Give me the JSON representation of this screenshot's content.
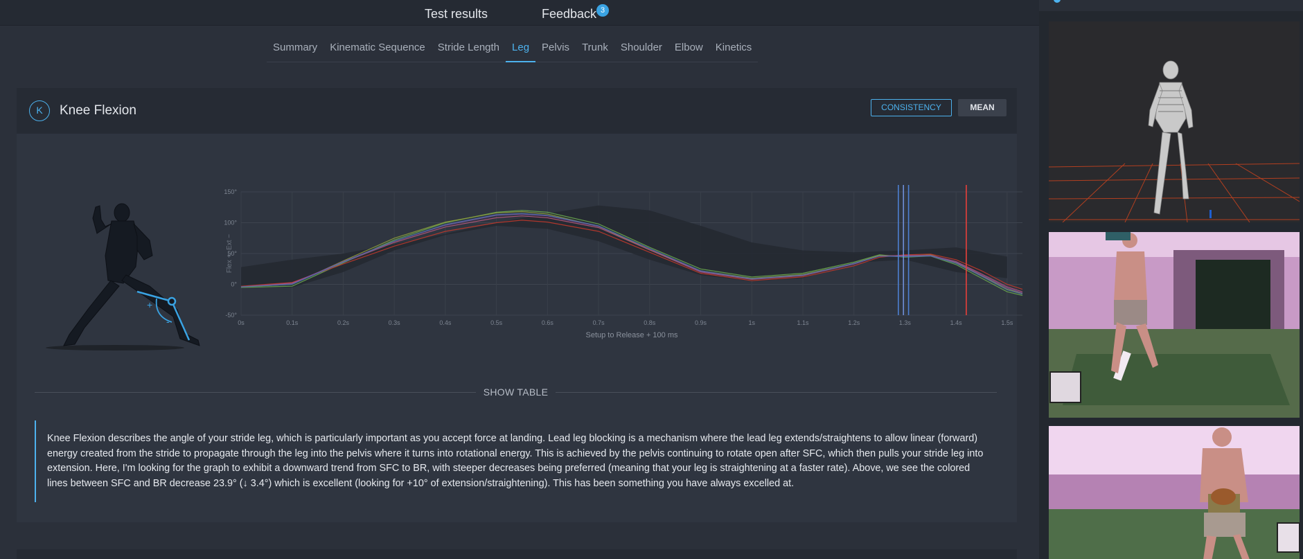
{
  "top_nav": {
    "tabs": [
      "Test results",
      "Feedback"
    ],
    "feedback_badge": "3"
  },
  "sub_tabs": [
    {
      "label": "Summary",
      "active": false
    },
    {
      "label": "Kinematic Sequence",
      "active": false
    },
    {
      "label": "Stride Length",
      "active": false
    },
    {
      "label": "Leg",
      "active": true
    },
    {
      "label": "Pelvis",
      "active": false
    },
    {
      "label": "Trunk",
      "active": false
    },
    {
      "label": "Shoulder",
      "active": false
    },
    {
      "label": "Elbow",
      "active": false
    },
    {
      "label": "Kinetics",
      "active": false
    }
  ],
  "card": {
    "icon_letter": "K",
    "title": "Knee Flexion",
    "btn_consistency": "CONSISTENCY",
    "btn_mean": "MEAN",
    "figure": {
      "plus": "+",
      "minus": "-"
    },
    "show_table": "SHOW TABLE",
    "description": "Knee Flexion describes the angle of your stride leg, which is particularly important as you accept force at landing. Lead leg blocking is a mechanism where the lead leg extends/straightens to allow linear (forward) energy created from the stride to propagate through the leg into the pelvis where it turns into rotational energy. This is achieved by the pelvis continuing to rotate open after SFC, which then pulls your stride leg into extension. Here, I'm looking for the graph to exhibit a downward trend from SFC to BR, with steeper decreases being preferred (meaning that your leg is straightening at a faster rate). Above, we see the colored lines between SFC and BR decrease 23.9° (↓ 3.4°) which is excellent (looking for +10° of extension/straightening). This has been something you have always excelled at."
  },
  "colors": {
    "accent": "#4db2ee",
    "background": "#2b303a",
    "card": "#2f3540",
    "release_line": "#e8403a"
  },
  "chart_data": {
    "type": "line",
    "xlabel": "Setup to Release + 100 ms",
    "ylabel": "Flex +, Ext −",
    "xlim": [
      0,
      1.53
    ],
    "ylim": [
      -50,
      150
    ],
    "x_ticks": [
      0,
      0.1,
      0.2,
      0.3,
      0.4,
      0.5,
      0.6,
      0.7,
      0.8,
      0.9,
      1.0,
      1.1,
      1.2,
      1.3,
      1.4,
      1.5
    ],
    "x_tick_labels": [
      "0s",
      "0.1s",
      "0.2s",
      "0.3s",
      "0.4s",
      "0.5s",
      "0.6s",
      "0.7s",
      "0.8s",
      "0.9s",
      "1s",
      "1.1s",
      "1.2s",
      "1.3s",
      "1.4s",
      "1.5s"
    ],
    "y_ticks": [
      -50,
      0,
      50,
      100,
      150
    ],
    "y_tick_labels": [
      "-50°",
      "0°",
      "50°",
      "100°",
      "150°"
    ],
    "grid": true,
    "band_x": [
      0,
      0.1,
      0.2,
      0.3,
      0.4,
      0.5,
      0.6,
      0.7,
      0.8,
      0.9,
      1.0,
      1.1,
      1.2,
      1.3,
      1.4,
      1.5
    ],
    "band_upper": [
      28,
      40,
      50,
      65,
      82,
      100,
      115,
      128,
      120,
      95,
      68,
      55,
      52,
      55,
      60,
      45
    ],
    "band_lower": [
      -5,
      -5,
      20,
      55,
      80,
      95,
      90,
      70,
      40,
      15,
      5,
      10,
      35,
      40,
      20,
      10
    ],
    "series": [
      {
        "color": "#6aa84f",
        "x": [
          0,
          0.1,
          0.2,
          0.3,
          0.4,
          0.5,
          0.55,
          0.6,
          0.7,
          0.8,
          0.9,
          1.0,
          1.1,
          1.2,
          1.25,
          1.3,
          1.35,
          1.4,
          1.45,
          1.5,
          1.53
        ],
        "y": [
          -5,
          -3,
          35,
          72,
          100,
          117,
          120,
          117,
          98,
          60,
          25,
          12,
          18,
          36,
          48,
          44,
          46,
          32,
          10,
          -12,
          -18
        ]
      },
      {
        "color": "#8e9f3c",
        "x": [
          0,
          0.1,
          0.2,
          0.3,
          0.4,
          0.5,
          0.55,
          0.6,
          0.7,
          0.8,
          0.9,
          1.0,
          1.1,
          1.2,
          1.25,
          1.3,
          1.35,
          1.4,
          1.45,
          1.5,
          1.53
        ],
        "y": [
          -4,
          0,
          38,
          75,
          101,
          116,
          118,
          114,
          94,
          56,
          22,
          10,
          16,
          34,
          47,
          46,
          48,
          35,
          14,
          -8,
          -15
        ]
      },
      {
        "color": "#c0392b",
        "x": [
          0,
          0.1,
          0.2,
          0.3,
          0.4,
          0.5,
          0.55,
          0.6,
          0.7,
          0.8,
          0.9,
          1.0,
          1.1,
          1.2,
          1.25,
          1.3,
          1.35,
          1.4,
          1.45,
          1.5,
          1.53
        ],
        "y": [
          -3,
          3,
          33,
          62,
          86,
          100,
          104,
          101,
          86,
          52,
          18,
          6,
          12,
          30,
          44,
          48,
          49,
          40,
          22,
          0,
          -8
        ]
      },
      {
        "color": "#b5577a",
        "x": [
          0,
          0.1,
          0.2,
          0.3,
          0.4,
          0.5,
          0.55,
          0.6,
          0.7,
          0.8,
          0.9,
          1.0,
          1.1,
          1.2,
          1.25,
          1.3,
          1.35,
          1.4,
          1.45,
          1.5,
          1.53
        ],
        "y": [
          -4,
          2,
          36,
          68,
          93,
          108,
          111,
          108,
          92,
          56,
          20,
          8,
          14,
          33,
          46,
          47,
          47,
          37,
          17,
          -4,
          -12
        ]
      },
      {
        "color": "#7d4fa0",
        "x": [
          0,
          0.1,
          0.2,
          0.3,
          0.4,
          0.5,
          0.55,
          0.6,
          0.7,
          0.8,
          0.9,
          1.0,
          1.1,
          1.2,
          1.25,
          1.3,
          1.35,
          1.4,
          1.45,
          1.5,
          1.53
        ],
        "y": [
          -4,
          1,
          37,
          70,
          96,
          112,
          114,
          111,
          94,
          58,
          21,
          9,
          15,
          33,
          46,
          46,
          47,
          36,
          15,
          -6,
          -14
        ]
      },
      {
        "color": "#4a6fa5",
        "x": [
          0,
          0.1,
          0.2,
          0.3,
          0.4,
          0.5,
          0.55,
          0.6,
          0.7,
          0.8,
          0.9,
          1.0,
          1.1,
          1.2,
          1.25,
          1.3,
          1.35,
          1.4,
          1.45,
          1.5,
          1.53
        ],
        "y": [
          -4,
          0,
          36,
          70,
          97,
          113,
          115,
          112,
          95,
          58,
          22,
          9,
          15,
          34,
          46,
          45,
          46,
          34,
          13,
          -9,
          -16
        ]
      }
    ],
    "markers": [
      {
        "x": 1.287,
        "color": "#4d7fd1"
      },
      {
        "x": 1.297,
        "color": "#6f8fd9"
      },
      {
        "x": 1.307,
        "color": "#4d7fd1"
      },
      {
        "x": 1.42,
        "color": "#e8403a"
      }
    ]
  },
  "right_panel": {
    "panels": [
      {
        "name": "3d-skeleton-view",
        "bg": "#2a2a2d"
      },
      {
        "name": "video-back-view",
        "bg": "#d49ad2"
      },
      {
        "name": "video-front-view",
        "bg": "#e2b3df"
      }
    ]
  }
}
